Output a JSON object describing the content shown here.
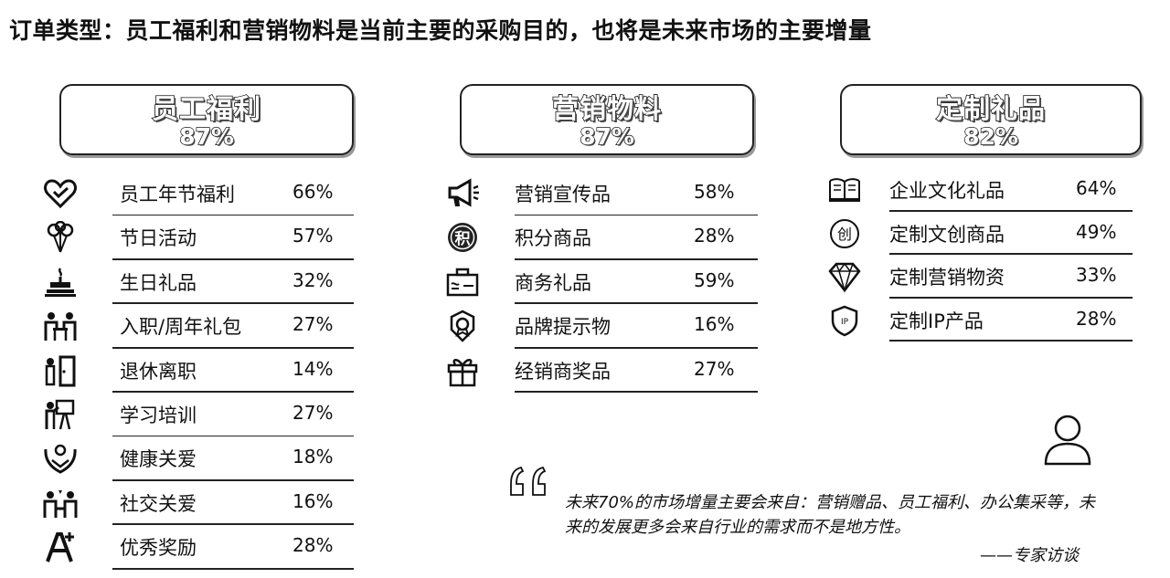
{
  "title": "订单类型：员工福利和营销物料是当前主要的采购目的，也将是未来市场的主要增量",
  "columns": [
    {
      "name": "员工福利",
      "percent": "87%",
      "items": [
        {
          "icon": "heart-icon",
          "label": "员工年节福利",
          "value": "66%"
        },
        {
          "icon": "balloons-icon",
          "label": "节日活动",
          "value": "57%"
        },
        {
          "icon": "birthday-cake-icon",
          "label": "生日礼品",
          "value": "32%"
        },
        {
          "icon": "people-table-icon",
          "label": "入职/周年礼包",
          "value": "27%"
        },
        {
          "icon": "exit-door-icon",
          "label": "退休离职",
          "value": "14%"
        },
        {
          "icon": "training-board-icon",
          "label": "学习培训",
          "value": "27%"
        },
        {
          "icon": "care-hands-icon",
          "label": "健康关爱",
          "value": "18%"
        },
        {
          "icon": "social-people-icon",
          "label": "社交关爱",
          "value": "16%"
        },
        {
          "icon": "award-letter-icon",
          "label": "优秀奖励",
          "value": "28%"
        }
      ]
    },
    {
      "name": "营销物料",
      "percent": "87%",
      "items": [
        {
          "icon": "megaphone-icon",
          "label": "营销宣传品",
          "value": "58%"
        },
        {
          "icon": "points-badge-icon",
          "label": "积分商品",
          "value": "28%"
        },
        {
          "icon": "briefcase-icon",
          "label": "商务礼品",
          "value": "59%"
        },
        {
          "icon": "brand-badge-icon",
          "label": "品牌提示物",
          "value": "16%"
        },
        {
          "icon": "gift-box-icon",
          "label": "经销商奖品",
          "value": "27%"
        }
      ]
    },
    {
      "name": "定制礼品",
      "percent": "82%",
      "items": [
        {
          "icon": "open-book-icon",
          "label": "企业文化礼品",
          "value": "64%"
        },
        {
          "icon": "creative-circle-icon",
          "label": "定制文创商品",
          "value": "49%"
        },
        {
          "icon": "diamond-icon",
          "label": "定制营销物资",
          "value": "33%"
        },
        {
          "icon": "ip-shield-icon",
          "label": "定制IP产品",
          "value": "28%"
        }
      ]
    }
  ],
  "quote": {
    "text": "未来70%的市场增量主要会来自：营销赠品、员工福利、办公集采等，未来的发展更多会来自行业的需求而不是地方性。",
    "source": "——专家访谈"
  }
}
